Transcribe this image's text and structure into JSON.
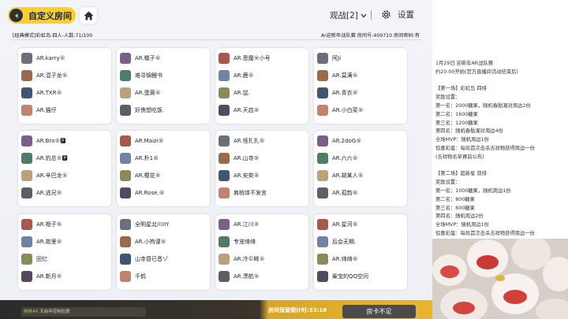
{
  "header": {
    "title": "自定义房间",
    "watch_label": "观战[2]",
    "settings_label": "设置"
  },
  "info": {
    "left": "[经典模式]彩虹岛-四人-人数:71/100",
    "right": "Ar迎新年战队赛 房间号:409710 房间密码:有"
  },
  "colors": {
    "accent": "#f8cf2f",
    "panel": "#ffffff"
  },
  "teams": [
    {
      "players": [
        {
          "name": "AR.karry®"
        },
        {
          "name": "AR.混子龙®"
        },
        {
          "name": "AR.TXR®"
        },
        {
          "name": "AR.猫仔"
        }
      ]
    },
    {
      "players": [
        {
          "name": "AR.橘子®"
        },
        {
          "name": "难寻锦鲤书"
        },
        {
          "name": "AR.蛋黄®"
        },
        {
          "name": "好憔想吃饭."
        }
      ]
    },
    {
      "players": [
        {
          "name": "AR.恩魔®小号"
        },
        {
          "name": "AR.鹿®"
        },
        {
          "name": "AR.鼠."
        },
        {
          "name": "AR.天启®"
        }
      ]
    },
    {
      "players": [
        {
          "name": "阿Ji"
        },
        {
          "name": "AR.莫满®"
        },
        {
          "name": "AR.青衣®"
        },
        {
          "name": "AR.小白菜®"
        }
      ]
    },
    {
      "players": [
        {
          "name": "AR.Bro®🅿"
        },
        {
          "name": "AR.豹总®🅿"
        },
        {
          "name": "AR.辛巴龙®"
        },
        {
          "name": "AR.逃兄®"
        }
      ]
    },
    {
      "players": [
        {
          "name": "AR.Maizi®"
        },
        {
          "name": "AR.朴1®"
        },
        {
          "name": "AR.樱花®"
        },
        {
          "name": "AR.Rose.®"
        }
      ]
    },
    {
      "players": [
        {
          "name": "AR.怪扎扎®"
        },
        {
          "name": "AR.山寺®"
        },
        {
          "name": "AR.安奕®"
        },
        {
          "name": "肩桃体不发言"
        }
      ]
    },
    {
      "players": [
        {
          "name": "AR.2doG®"
        },
        {
          "name": "AR.六六®"
        },
        {
          "name": "AR.胡某人®"
        },
        {
          "name": "AR.孤韵®"
        }
      ]
    },
    {
      "players": [
        {
          "name": "AR.橙子®"
        },
        {
          "name": "AR.故里®"
        },
        {
          "name": "回忆"
        },
        {
          "name": "AR.新月®"
        }
      ]
    },
    {
      "players": [
        {
          "name": "全明星北川IIY"
        },
        {
          "name": "AR.小拘谨®"
        },
        {
          "name": "山寺昼已音ゾ"
        },
        {
          "name": "千鹤"
        }
      ]
    },
    {
      "players": [
        {
          "name": "AR.江川®"
        },
        {
          "name": "专宠绮绮"
        },
        {
          "name": "AR.冷©眸®"
        },
        {
          "name": "AR.漂航®"
        }
      ]
    },
    {
      "players": [
        {
          "name": "AR.星河®"
        },
        {
          "name": "后会无期."
        },
        {
          "name": "AR.绮绮®"
        },
        {
          "name": "柴宝的QQ空间"
        }
      ]
    }
  ],
  "bottom": {
    "ticker_prefix": "蚌蚌AR",
    "ticker": "天启年控制拉跌",
    "countdown": "房间保留倒计时:33:18",
    "room_status": "房卡不足"
  },
  "side_panel": {
    "lines": [
      "1月29日 迎新年AR战队赛",
      "约20:00开始(官方直播间活动结束后)",
      "",
      "【第一场】彩虹岛  四排",
      "奖励设置：",
      "第一名：2000糖果，随机春骷潮对周边2份",
      "第二名：1600糖果",
      "第三名：1200糖果",
      "第四名：随机春骷潮对周边4份",
      "全场MVP：随机周边1份",
      "惊喜彩蛋：每局首次击杀吉祥物获得周边一份",
      "(吉祥物名单赛前公布)",
      "",
      "【第二场】超新星  双排",
      "奖励设置：",
      "第一名：1000糖果，随机周边1份",
      "第二名：800糖果",
      "第三名：600糖果",
      "第四名：随机周边2份",
      "全场MVP：随机周边1份",
      "惊喜彩蛋：每局首次击杀吉祥物获得周边一份"
    ]
  }
}
